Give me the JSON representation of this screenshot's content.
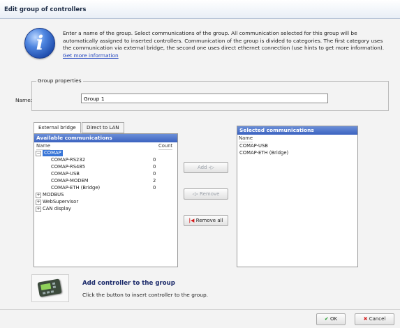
{
  "window": {
    "title": "Edit group of controllers"
  },
  "info": {
    "icon": "info-icon",
    "text": "Enter a name of the group. Select communications of the group. All communication selected for this group will be automatically assigned to inserted controllers. Communication of the group is divided to categories. The first category uses the communication via external bridge, the second one uses direct ethernet connection (use hints to get more information).",
    "link": "Get more information"
  },
  "group_properties": {
    "legend": "Group properties",
    "name_label": "Name:",
    "name_value": "Group 1"
  },
  "tabs": [
    {
      "label": "External bridge",
      "active": true
    },
    {
      "label": "Direct to LAN",
      "active": false
    }
  ],
  "available": {
    "title": "Available communications",
    "col_name": "Name",
    "col_count": "Count",
    "group": "COMAP",
    "items": [
      {
        "name": "COMAP-RS232",
        "count": "0"
      },
      {
        "name": "COMAP-RS485",
        "count": "0"
      },
      {
        "name": "COMAP-USB",
        "count": "0"
      },
      {
        "name": "COMAP-MODEM",
        "count": "2"
      },
      {
        "name": "COMAP-ETH (Bridge)",
        "count": "0"
      }
    ],
    "other_groups": [
      "MODBUS",
      "WebSupervisor",
      "CAN display"
    ]
  },
  "actions": {
    "add": "Add",
    "remove": "Remove",
    "remove_all": "Remove all"
  },
  "selected": {
    "title": "Selected communications",
    "col_name": "Name",
    "items": [
      "COMAP-USB",
      "COMAP-ETH (Bridge)"
    ]
  },
  "add_controller": {
    "title": "Add controller to the group",
    "description": "Click the button to insert controller to the group."
  },
  "footer": {
    "ok": "OK",
    "cancel": "Cancel"
  },
  "colors": {
    "accent_header": "#3b62c0",
    "selection": "#3875d7",
    "link": "#1b3fbd"
  }
}
